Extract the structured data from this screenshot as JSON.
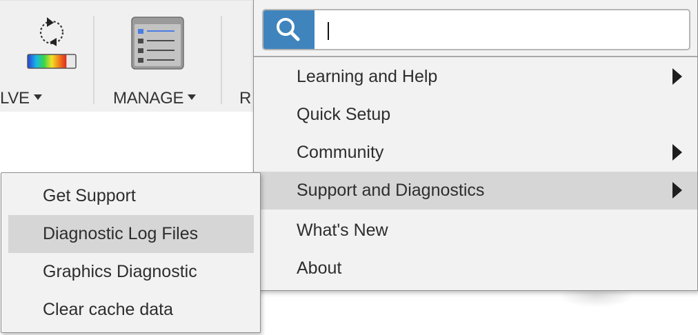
{
  "ribbon": {
    "groups": [
      {
        "label": "LVE",
        "icon": "solve-icon"
      },
      {
        "label": "MANAGE",
        "icon": "manage-icon"
      },
      {
        "label": "R",
        "icon": ""
      }
    ]
  },
  "main_menu": {
    "search": {
      "value": "",
      "icon": "search-icon"
    },
    "items": [
      {
        "label": "Learning and Help",
        "submenu": true,
        "highlighted": false
      },
      {
        "label": "Quick Setup",
        "submenu": false,
        "highlighted": false
      },
      {
        "label": "Community",
        "submenu": true,
        "highlighted": false
      },
      {
        "label": "Support and Diagnostics",
        "submenu": true,
        "highlighted": true
      },
      {
        "label": "What's New",
        "submenu": false,
        "highlighted": false
      },
      {
        "label": "About",
        "submenu": false,
        "highlighted": false
      }
    ]
  },
  "sub_menu": {
    "items": [
      {
        "label": "Get Support",
        "highlighted": false
      },
      {
        "label": "Diagnostic Log Files",
        "highlighted": true
      },
      {
        "label": "Graphics Diagnostic",
        "highlighted": false
      },
      {
        "label": "Clear cache data",
        "highlighted": false
      }
    ]
  },
  "colors": {
    "accent": "#3f84bd",
    "highlight": "#d6d6d6",
    "menu_background": "#f2f2f2",
    "ribbon_background": "#f0f0f0"
  }
}
